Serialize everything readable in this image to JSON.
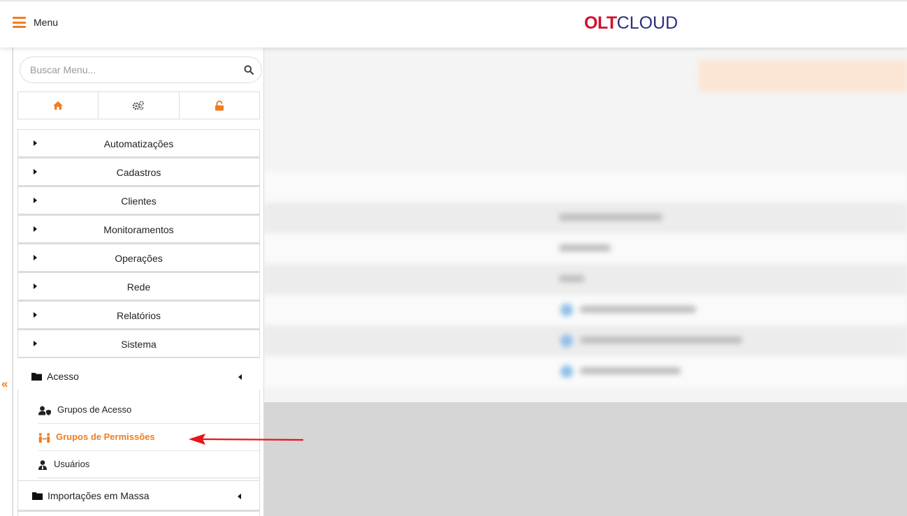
{
  "header": {
    "menu_label": "Menu",
    "logo_part1": "OLT",
    "logo_part2": "CLOUD"
  },
  "sidebar": {
    "search_placeholder": "Buscar Menu...",
    "quick_icons": [
      "home-icon",
      "gears-icon",
      "unlock-icon"
    ],
    "items": [
      {
        "label": "Automatizações"
      },
      {
        "label": "Cadastros"
      },
      {
        "label": "Clientes"
      },
      {
        "label": "Monitoramentos"
      },
      {
        "label": "Operações"
      },
      {
        "label": "Rede"
      },
      {
        "label": "Relatórios"
      },
      {
        "label": "Sistema"
      }
    ],
    "sistema_children": {
      "acesso": {
        "label": "Acesso",
        "children": [
          {
            "label": "Grupos de Acesso",
            "icon": "user-shield-icon"
          },
          {
            "label": "Grupos de Permissões",
            "icon": "people-arrows-icon",
            "active": true
          },
          {
            "label": "Usuários",
            "icon": "user-tie-icon"
          }
        ]
      },
      "importacoes": {
        "label": "Importações em Massa"
      }
    },
    "collapse_glyph": "«"
  },
  "colors": {
    "accent": "#f07d1e",
    "logo_red": "#d0112b",
    "logo_blue": "#2c2f7a",
    "annotation_arrow": "#e8141b"
  }
}
